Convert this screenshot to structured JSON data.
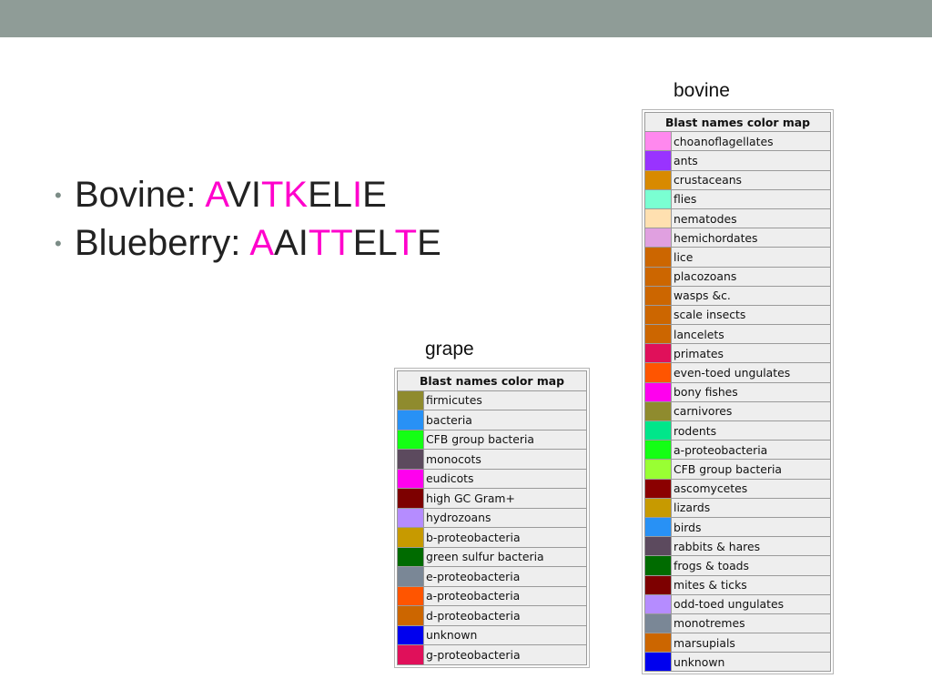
{
  "bullets": [
    {
      "label": "Bovine:",
      "sequence": [
        {
          "ch": "A",
          "color": "#ff00cc"
        },
        {
          "ch": "V",
          "color": "#222222"
        },
        {
          "ch": "I",
          "color": "#222222"
        },
        {
          "ch": "T",
          "color": "#ff00cc"
        },
        {
          "ch": "K",
          "color": "#ff00cc"
        },
        {
          "ch": "E",
          "color": "#222222"
        },
        {
          "ch": "L",
          "color": "#222222"
        },
        {
          "ch": "I",
          "color": "#ff00cc"
        },
        {
          "ch": "E",
          "color": "#222222"
        }
      ]
    },
    {
      "label": "Blueberry:",
      "sequence": [
        {
          "ch": "A",
          "color": "#ff00cc"
        },
        {
          "ch": "A",
          "color": "#222222"
        },
        {
          "ch": "I",
          "color": "#222222"
        },
        {
          "ch": "T",
          "color": "#ff00cc"
        },
        {
          "ch": "T",
          "color": "#ff00cc"
        },
        {
          "ch": "E",
          "color": "#222222"
        },
        {
          "ch": "L",
          "color": "#222222"
        },
        {
          "ch": "T",
          "color": "#ff00cc"
        },
        {
          "ch": "E",
          "color": "#222222"
        }
      ]
    }
  ],
  "grape": {
    "caption": "grape",
    "header": "Blast names color map",
    "rows": [
      {
        "name": "firmicutes",
        "color": "#8f8b2e"
      },
      {
        "name": "bacteria",
        "color": "#2891f5"
      },
      {
        "name": "CFB group bacteria",
        "color": "#14ff14"
      },
      {
        "name": "monocots",
        "color": "#5c4a5e"
      },
      {
        "name": "eudicots",
        "color": "#ff00ee"
      },
      {
        "name": "high GC Gram+",
        "color": "#7d0000"
      },
      {
        "name": "hydrozoans",
        "color": "#b58cff"
      },
      {
        "name": "b-proteobacteria",
        "color": "#c79a00"
      },
      {
        "name": "green sulfur bacteria",
        "color": "#006b00"
      },
      {
        "name": "e-proteobacteria",
        "color": "#7a8796"
      },
      {
        "name": "a-proteobacteria",
        "color": "#ff5500"
      },
      {
        "name": "d-proteobacteria",
        "color": "#cc6600"
      },
      {
        "name": "unknown",
        "color": "#0000ee"
      },
      {
        "name": "g-proteobacteria",
        "color": "#e0105a"
      }
    ]
  },
  "bovine": {
    "caption": "bovine",
    "header": "Blast names color map",
    "rows": [
      {
        "name": "choanoflagellates",
        "color": "#ff88ee"
      },
      {
        "name": "ants",
        "color": "#9933ff"
      },
      {
        "name": "crustaceans",
        "color": "#d88a00"
      },
      {
        "name": "flies",
        "color": "#7affd2"
      },
      {
        "name": "nematodes",
        "color": "#ffe0b0"
      },
      {
        "name": "hemichordates",
        "color": "#e0a0e0"
      },
      {
        "name": "lice",
        "color": "#cc6600"
      },
      {
        "name": "placozoans",
        "color": "#cc6600"
      },
      {
        "name": "wasps &c.",
        "color": "#cc6600"
      },
      {
        "name": "scale insects",
        "color": "#cc6600"
      },
      {
        "name": "lancelets",
        "color": "#cc6600"
      },
      {
        "name": "primates",
        "color": "#e0105a"
      },
      {
        "name": "even-toed ungulates",
        "color": "#ff5500"
      },
      {
        "name": "bony fishes",
        "color": "#ff00ee"
      },
      {
        "name": "carnivores",
        "color": "#8f8b2e"
      },
      {
        "name": "rodents",
        "color": "#00e68a"
      },
      {
        "name": "a-proteobacteria",
        "color": "#14ff14"
      },
      {
        "name": "CFB group bacteria",
        "color": "#99ff33"
      },
      {
        "name": "ascomycetes",
        "color": "#8b0000"
      },
      {
        "name": "lizards",
        "color": "#c79a00"
      },
      {
        "name": "birds",
        "color": "#2891f5"
      },
      {
        "name": "rabbits & hares",
        "color": "#5c4a5e"
      },
      {
        "name": "frogs & toads",
        "color": "#006b00"
      },
      {
        "name": "mites & ticks",
        "color": "#7d0000"
      },
      {
        "name": "odd-toed ungulates",
        "color": "#b58cff"
      },
      {
        "name": "monotremes",
        "color": "#7a8796"
      },
      {
        "name": "marsupials",
        "color": "#cc6600"
      },
      {
        "name": "unknown",
        "color": "#0000ee"
      }
    ]
  }
}
